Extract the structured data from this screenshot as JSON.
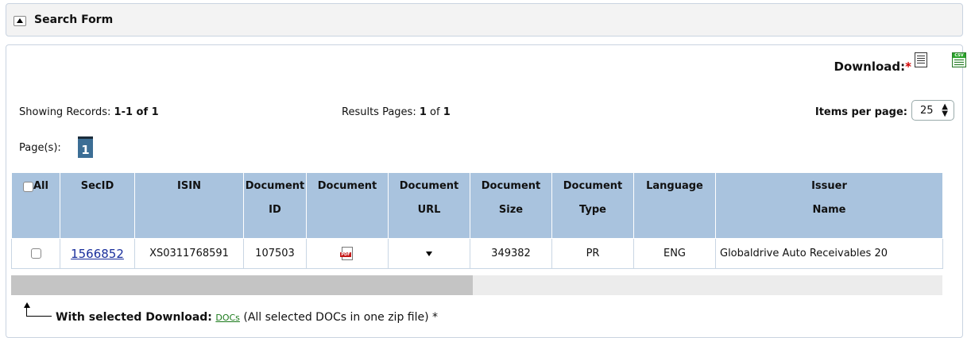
{
  "search_form": {
    "title": "Search Form"
  },
  "download": {
    "label": "Download:",
    "required_mark": "*",
    "icons": [
      "doc-list-icon",
      "csv-icon"
    ]
  },
  "records": {
    "showing_label": "Showing Records:",
    "showing_value": "1-1 of 1",
    "results_label": "Results Pages:",
    "results_current": "1",
    "results_of": "of",
    "results_total": "1",
    "items_per_page_label": "Items per page:",
    "items_per_page_value": "25"
  },
  "pagination": {
    "label": "Page(s):",
    "current": "1"
  },
  "table": {
    "headers": [
      {
        "l1": "All",
        "l2": ""
      },
      {
        "l1": "SecID",
        "l2": ""
      },
      {
        "l1": "ISIN",
        "l2": ""
      },
      {
        "l1": "Document",
        "l2": "ID"
      },
      {
        "l1": "Document",
        "l2": ""
      },
      {
        "l1": "Document",
        "l2": "URL"
      },
      {
        "l1": "Document",
        "l2": "Size"
      },
      {
        "l1": "Document",
        "l2": "Type"
      },
      {
        "l1": "Language",
        "l2": ""
      },
      {
        "l1": "Issuer",
        "l2": "Name"
      }
    ],
    "rows": [
      {
        "secid": "1566852",
        "isin": "XS0311768591",
        "document_id": "107503",
        "document_icon": "pdf-icon",
        "document_size": "349382",
        "document_type": "PR",
        "language": "ENG",
        "issuer_name": "Globaldrive Auto Receivables 20"
      }
    ]
  },
  "footer": {
    "label": "With selected Download:",
    "link": "DOCs",
    "note": "(All selected DOCs in one zip file) *"
  }
}
